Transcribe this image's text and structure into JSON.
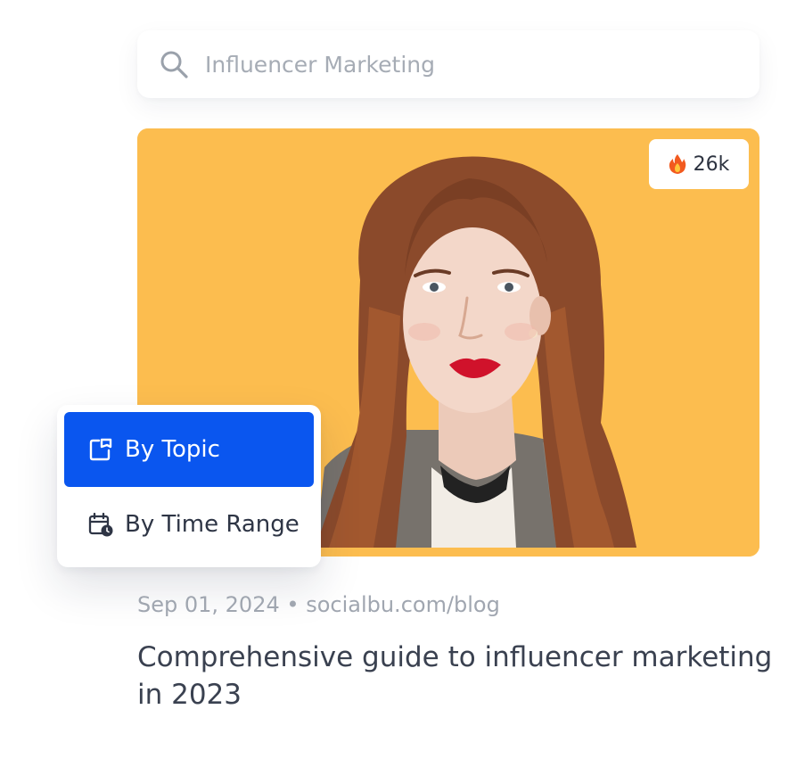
{
  "search": {
    "placeholder": "Influencer Marketing",
    "icon": "search-icon"
  },
  "article": {
    "trend": {
      "icon": "fire-icon",
      "count": "26k"
    },
    "date": "Sep 01, 2024",
    "separator": "•",
    "source": "socialbu.com/blog",
    "title": "Comprehensive guide to influencer marketing in 2023"
  },
  "filter": {
    "options": [
      {
        "label": "By Topic",
        "icon": "topic-icon",
        "active": true
      },
      {
        "label": "By Time Range",
        "icon": "calendar-clock-icon",
        "active": false
      }
    ]
  },
  "colors": {
    "accent": "#0a56ef",
    "image_background": "#fcbd4f",
    "muted_text": "#a0a6b0",
    "body_text": "#3a4150"
  }
}
